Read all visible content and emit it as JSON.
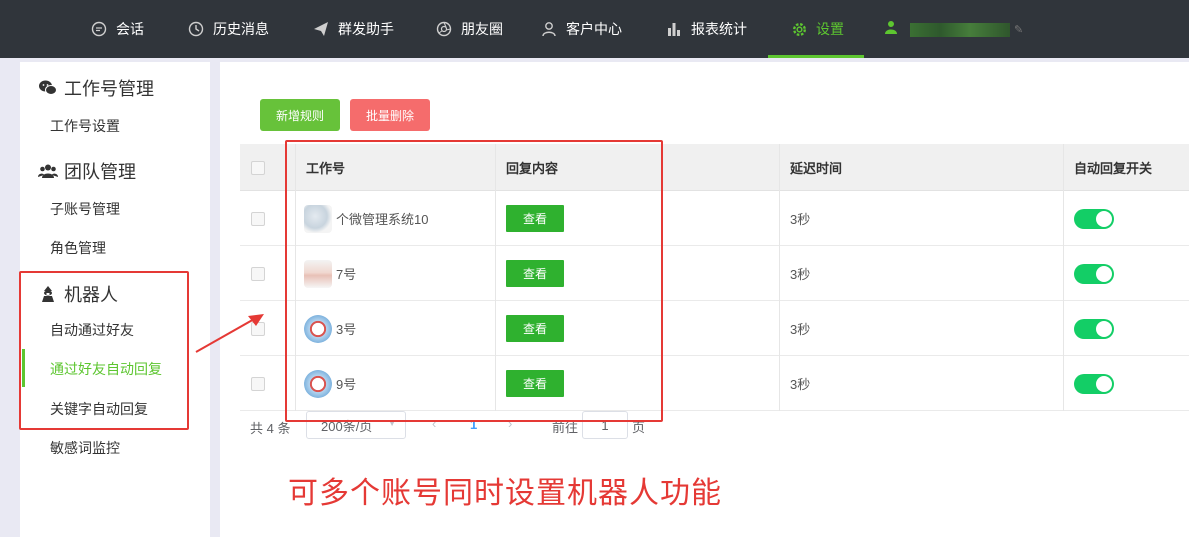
{
  "topnav": {
    "items": [
      {
        "label": "会话",
        "icon": "chat-icon"
      },
      {
        "label": "历史消息",
        "icon": "clock-icon"
      },
      {
        "label": "群发助手",
        "icon": "send-icon"
      },
      {
        "label": "朋友圈",
        "icon": "aperture-icon"
      },
      {
        "label": "客户中心",
        "icon": "person-icon"
      },
      {
        "label": "报表统计",
        "icon": "bar-chart-icon"
      },
      {
        "label": "设置",
        "icon": "gear-icon",
        "active": true
      }
    ],
    "user_icon": "user-icon",
    "accent_color": "#5dc630"
  },
  "sidebar": {
    "groups": [
      {
        "title": "工作号管理",
        "icon": "wechat-icon",
        "items": [
          "工作号设置"
        ]
      },
      {
        "title": "团队管理",
        "icon": "team-icon",
        "items": [
          "子账号管理",
          "角色管理"
        ]
      },
      {
        "title": "机器人",
        "icon": "robot-icon",
        "items": [
          "自动通过好友",
          "通过好友自动回复",
          "关键字自动回复",
          "敏感词监控"
        ]
      }
    ],
    "active_item": "通过好友自动回复"
  },
  "toolbar": {
    "add_label": "新增规则",
    "delete_label": "批量删除"
  },
  "table": {
    "columns": [
      "工作号",
      "回复内容",
      "延迟时间",
      "自动回复开关"
    ],
    "rows": [
      {
        "account": "个微管理系统10",
        "reply": "查看",
        "delay": "3秒",
        "auto_reply": true
      },
      {
        "account": "7号",
        "reply": "查看",
        "delay": "3秒",
        "auto_reply": true
      },
      {
        "account": "3号",
        "reply": "查看",
        "delay": "3秒",
        "auto_reply": true
      },
      {
        "account": "9号",
        "reply": "查看",
        "delay": "3秒",
        "auto_reply": true
      }
    ]
  },
  "pagination": {
    "total": "共 4 条",
    "page_size": "200条/页",
    "prev": "‹",
    "current": "1",
    "next": "›",
    "goto_label": "前往",
    "page_input": "1",
    "page_unit": "页"
  },
  "annotation": {
    "text": "可多个账号同时设置机器人功能",
    "color": "#e53935"
  }
}
